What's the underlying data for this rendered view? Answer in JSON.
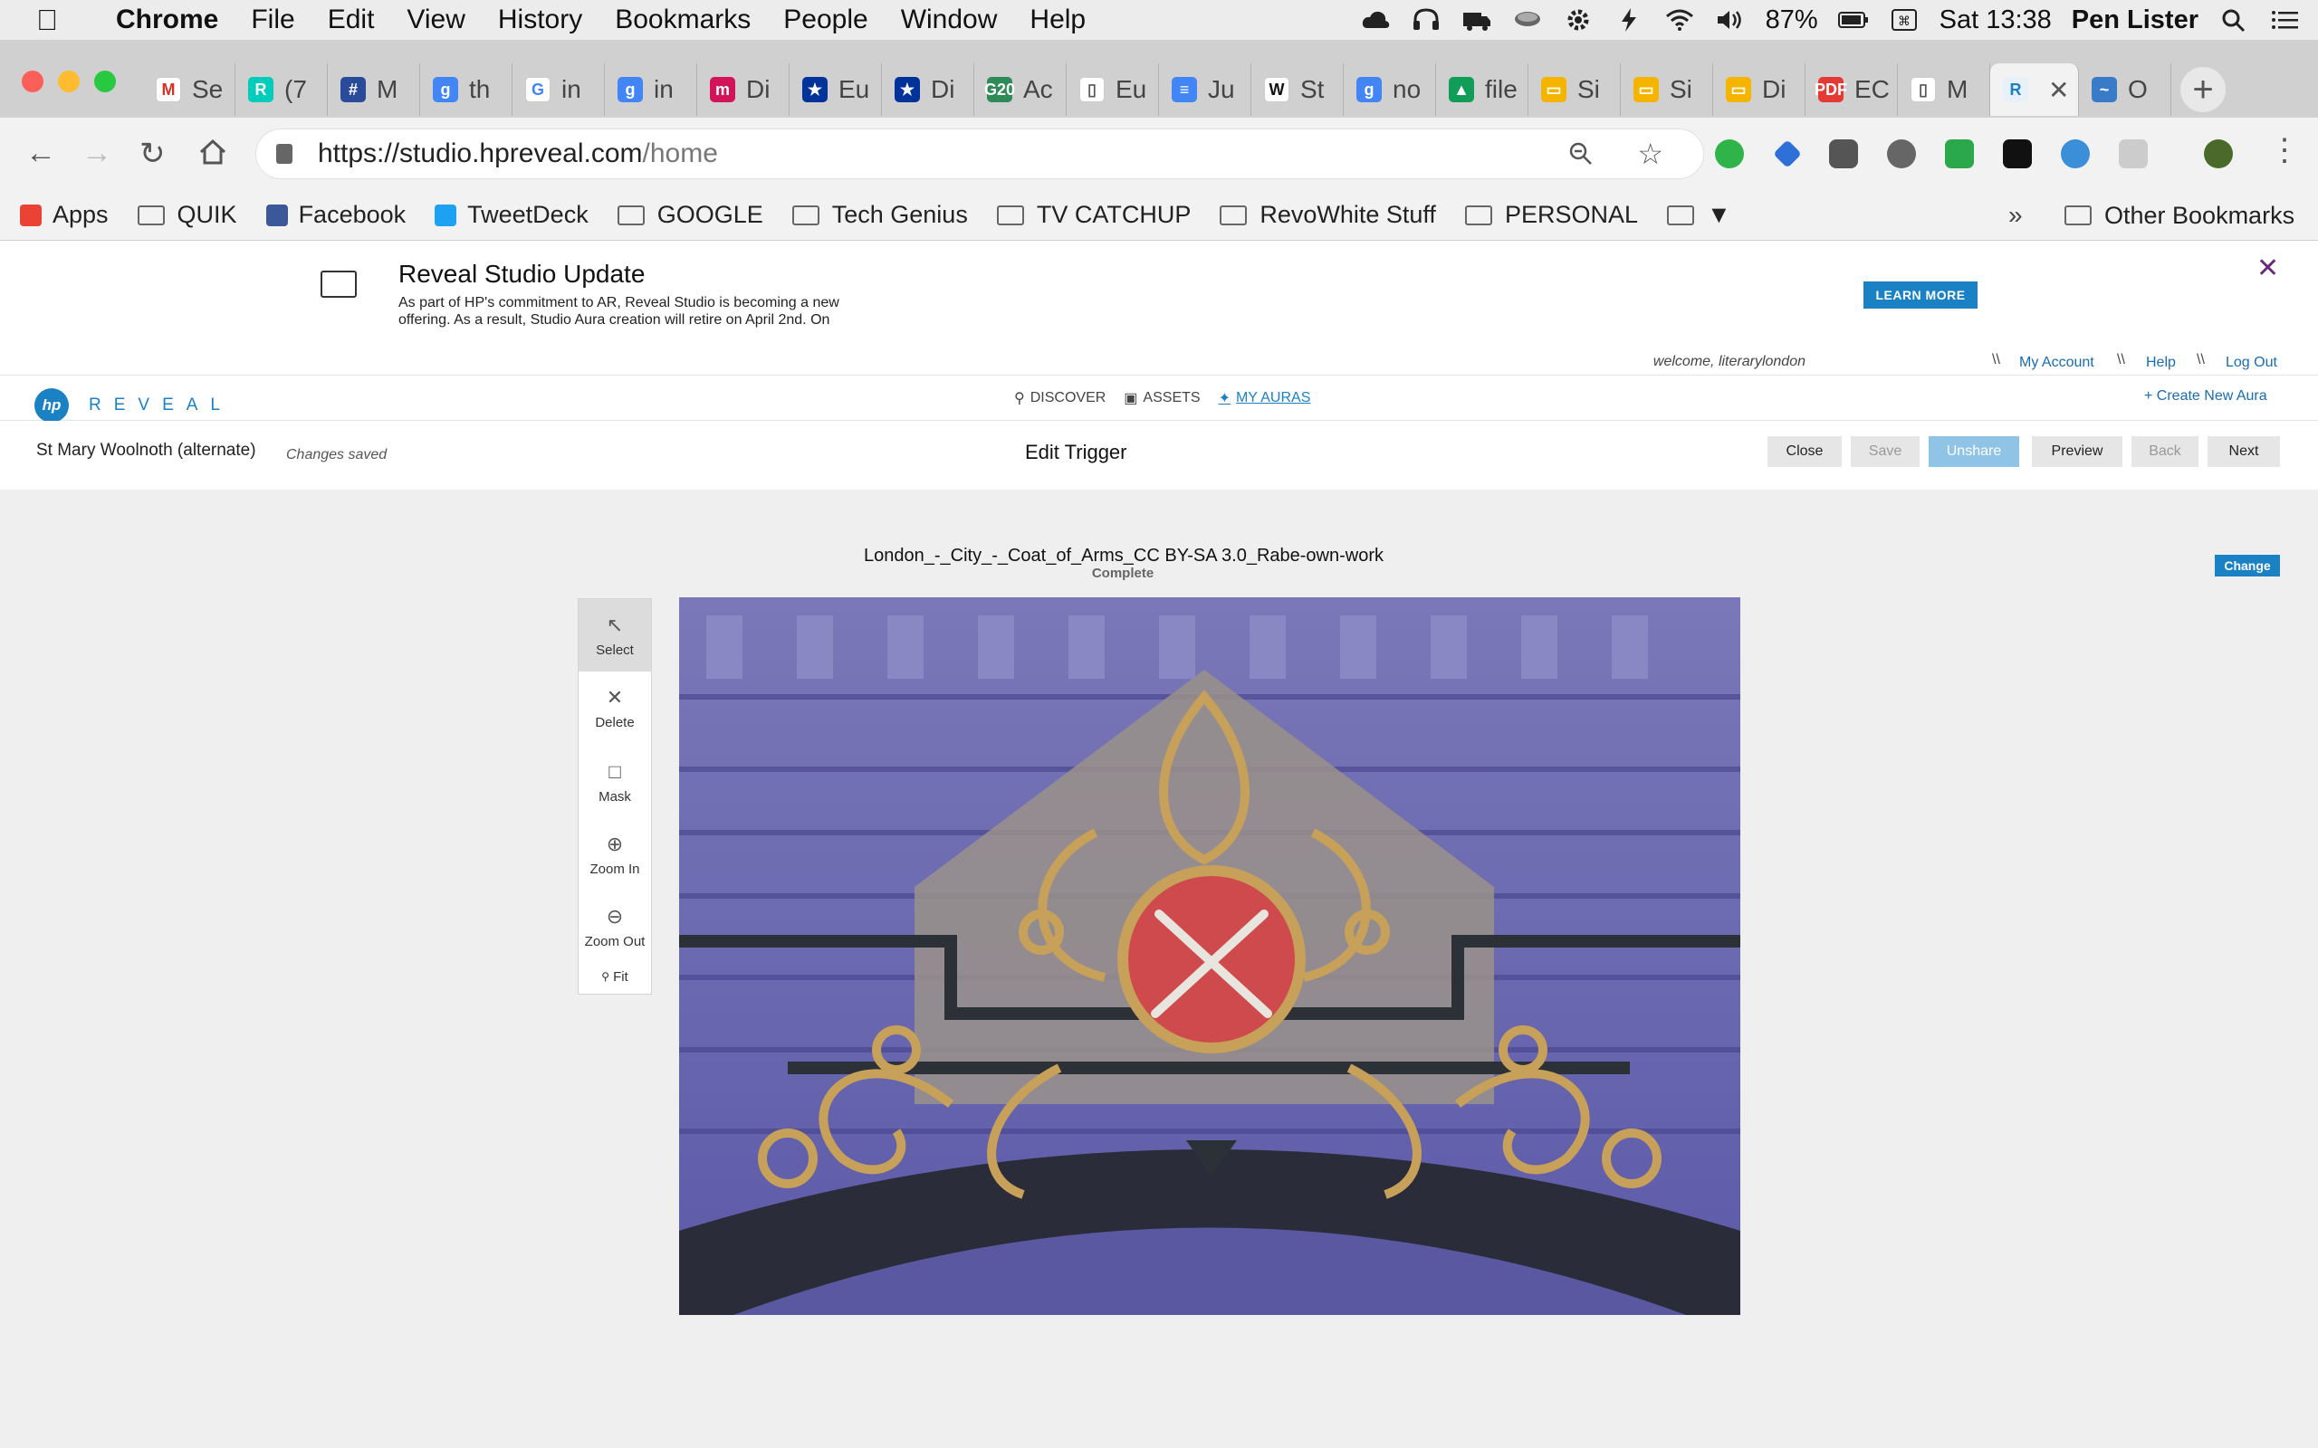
{
  "menubar": {
    "app": "Chrome",
    "items": [
      "File",
      "Edit",
      "View",
      "History",
      "Bookmarks",
      "People",
      "Window",
      "Help"
    ],
    "battery": "87%",
    "clock": "Sat 13:38",
    "user": "Pen Lister"
  },
  "tabs": [
    {
      "icon": "gmail-icon",
      "label": "Se",
      "color": "#ffffff",
      "glyph": "M",
      "glyph_color": "#d93025"
    },
    {
      "icon": "researchgate-icon",
      "label": "(7",
      "color": "#00ccbb",
      "glyph": "R"
    },
    {
      "icon": "grid-icon",
      "label": "M",
      "color": "#2a4a9a",
      "glyph": "#"
    },
    {
      "icon": "google-translate-icon",
      "label": "th",
      "color": "#4285f4",
      "glyph": "g"
    },
    {
      "icon": "google-icon",
      "label": "in",
      "color": "#ffffff",
      "glyph": "G",
      "glyph_color": "#4285f4"
    },
    {
      "icon": "google-translate-icon",
      "label": "in",
      "color": "#4285f4",
      "glyph": "g"
    },
    {
      "icon": "mendeley-icon",
      "label": "Di",
      "color": "#d4145a",
      "glyph": "m"
    },
    {
      "icon": "eu-flag-icon",
      "label": "Eu",
      "color": "#003399",
      "glyph": "★"
    },
    {
      "icon": "eu-flag-icon",
      "label": "Di",
      "color": "#003399",
      "glyph": "★"
    },
    {
      "icon": "g20-icon",
      "label": "Ac",
      "color": "#2e8b57",
      "glyph": "G20"
    },
    {
      "icon": "document-icon",
      "label": "Eu",
      "color": "#ffffff",
      "glyph": "▯",
      "glyph_color": "#555555"
    },
    {
      "icon": "google-docs-icon",
      "label": "Ju",
      "color": "#4285f4",
      "glyph": "≡"
    },
    {
      "icon": "wikipedia-icon",
      "label": "St",
      "color": "#ffffff",
      "glyph": "W",
      "glyph_color": "#111111"
    },
    {
      "icon": "google-translate-icon",
      "label": "no",
      "color": "#4285f4",
      "glyph": "g"
    },
    {
      "icon": "google-drive-icon",
      "label": "file",
      "color": "#0f9d58",
      "glyph": "▲"
    },
    {
      "icon": "google-slides-icon",
      "label": "Si",
      "color": "#f4b400",
      "glyph": "▭"
    },
    {
      "icon": "google-slides-icon",
      "label": "Si",
      "color": "#f4b400",
      "glyph": "▭"
    },
    {
      "icon": "google-slides-icon",
      "label": "Di",
      "color": "#f4b400",
      "glyph": "▭"
    },
    {
      "icon": "pdf-icon",
      "label": "EC",
      "color": "#e53935",
      "glyph": "PDF"
    },
    {
      "icon": "document-icon",
      "label": "M",
      "color": "#ffffff",
      "glyph": "▯",
      "glyph_color": "#555555"
    },
    {
      "icon": "hp-reveal-icon",
      "label": "",
      "color": "#e8f0fa",
      "glyph": "R",
      "glyph_color": "#1a82c4",
      "active": true
    },
    {
      "icon": "ocean-icon",
      "label": "O",
      "color": "#3a7bc8",
      "glyph": "~"
    }
  ],
  "toolbar": {
    "url_host": "https://studio.hpreveal.com",
    "url_path": "/home"
  },
  "bookmarks": [
    {
      "label": "Apps",
      "type": "apps"
    },
    {
      "label": "QUIK",
      "type": "folder"
    },
    {
      "label": "Facebook",
      "type": "facebook"
    },
    {
      "label": "TweetDeck",
      "type": "twitter"
    },
    {
      "label": "GOOGLE",
      "type": "folder"
    },
    {
      "label": "Tech Genius",
      "type": "folder"
    },
    {
      "label": "TV CATCHUP",
      "type": "folder"
    },
    {
      "label": "RevoWhite Stuff",
      "type": "folder"
    },
    {
      "label": "PERSONAL",
      "type": "folder"
    },
    {
      "label": "▼",
      "type": "folder"
    }
  ],
  "bookmarks_other": "Other Bookmarks",
  "bookmarks_overflow": "»",
  "banner": {
    "title": "Reveal Studio Update",
    "body": "As part of HP's commitment to AR, Reveal Studio is becoming a new offering. As a result, Studio Aura creation will retire on April 2nd. On",
    "button": "LEARN MORE",
    "close": "✕"
  },
  "usernav": {
    "welcome": "welcome, literarylondon",
    "sep": "\\\\",
    "my_account": "My Account",
    "help": "Help",
    "logout": "Log Out"
  },
  "appnav": {
    "logo_mark": "hp",
    "logo_text": "REVEAL",
    "discover": "DISCOVER",
    "assets": "ASSETS",
    "my_auras": "MY AURAS",
    "create": "Create New Aura"
  },
  "editbar": {
    "aura_name": "St Mary Woolnoth (alternate)",
    "status": "Changes saved",
    "title": "Edit Trigger",
    "buttons": {
      "close": "Close",
      "save": "Save",
      "unshare": "Unshare",
      "preview": "Preview",
      "back": "Back",
      "next": "Next"
    }
  },
  "trigger": {
    "filename": "London_-_City_-_Coat_of_Arms_CC BY-SA 3.0_Rabe-own-work",
    "status": "Complete",
    "change": "Change"
  },
  "tools": {
    "select": "Select",
    "delete": "Delete",
    "mask": "Mask",
    "zoom_in": "Zoom In",
    "zoom_out": "Zoom Out",
    "fit": "Fit"
  }
}
